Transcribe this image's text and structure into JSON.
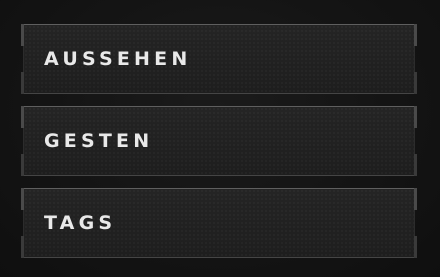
{
  "menu": {
    "items": [
      {
        "label": "AUSSEHEN"
      },
      {
        "label": "GESTEN"
      },
      {
        "label": "TAGS"
      }
    ]
  }
}
